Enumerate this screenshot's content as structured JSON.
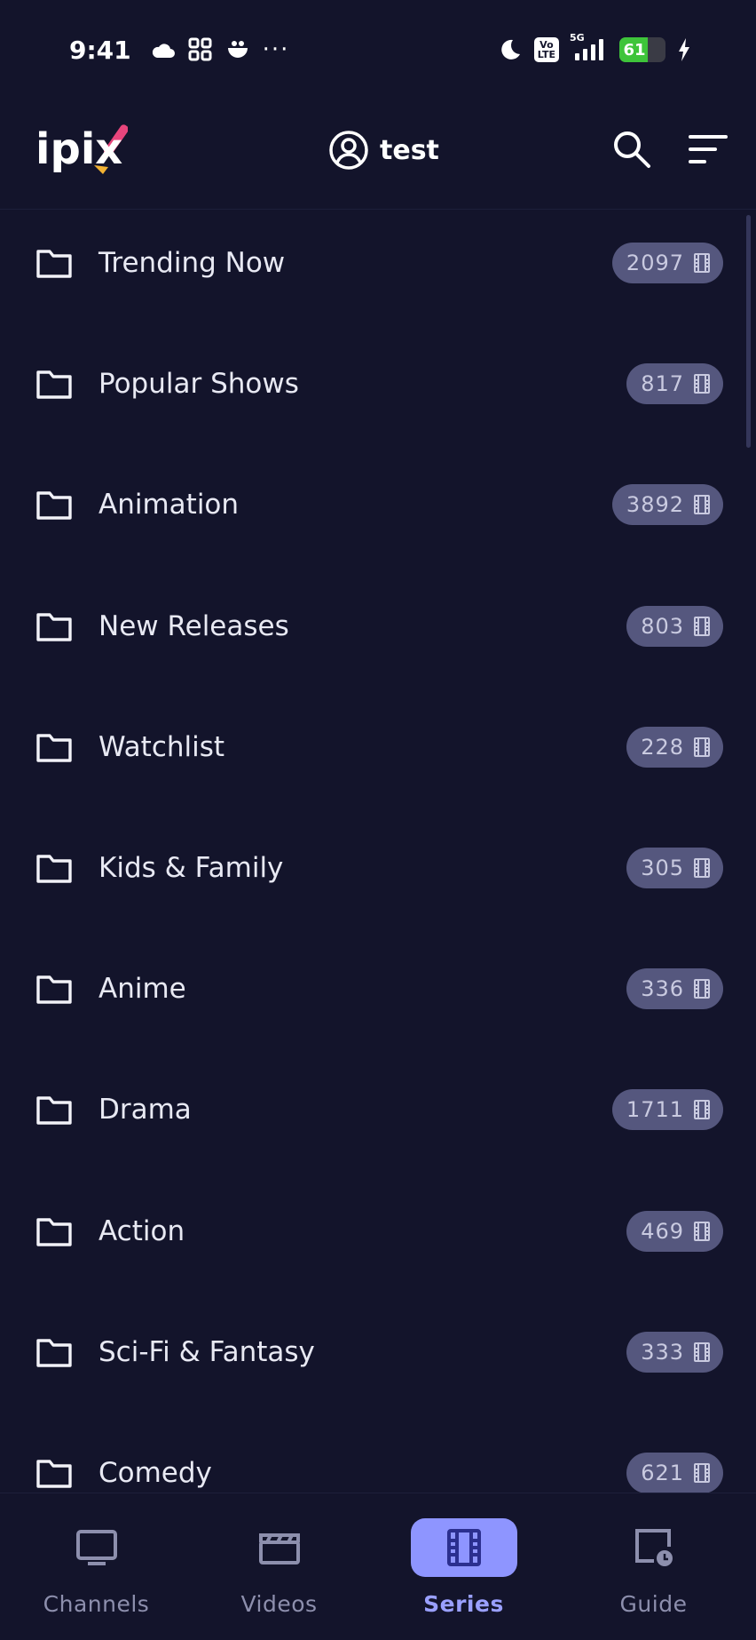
{
  "status_bar": {
    "time": "9:41",
    "network": "5G",
    "volte_top": "Vo",
    "volte_bottom": "LTE",
    "battery": "61",
    "battery_level": 0.61,
    "icons": [
      "cloud-icon",
      "grid-app-icon",
      "robot-icon",
      "more-dots-icon",
      "moon-icon",
      "volte-icon",
      "signal-icon",
      "battery-icon",
      "charging-icon"
    ]
  },
  "header": {
    "logo_text": "ipix",
    "username": "test",
    "icons": [
      "user-circle-icon",
      "search-icon",
      "sort-icon"
    ]
  },
  "categories": [
    {
      "label": "Trending Now",
      "count": "2097"
    },
    {
      "label": "Popular Shows",
      "count": "817"
    },
    {
      "label": "Animation",
      "count": "3892"
    },
    {
      "label": "New Releases",
      "count": "803"
    },
    {
      "label": "Watchlist",
      "count": "228"
    },
    {
      "label": "Kids & Family",
      "count": "305"
    },
    {
      "label": "Anime",
      "count": "336"
    },
    {
      "label": "Drama",
      "count": "1711"
    },
    {
      "label": "Action",
      "count": "469"
    },
    {
      "label": "Sci-Fi & Fantasy",
      "count": "333"
    },
    {
      "label": "Comedy",
      "count": "621"
    }
  ],
  "bottom_nav": {
    "items": [
      {
        "label": "Channels",
        "icon": "tv-icon"
      },
      {
        "label": "Videos",
        "icon": "clapperboard-icon"
      },
      {
        "label": "Series",
        "icon": "film-strip-icon"
      },
      {
        "label": "Guide",
        "icon": "guide-clock-icon"
      }
    ],
    "active": "Series"
  },
  "colors": {
    "background": "#13142b",
    "badge": "#55577e",
    "accent": "#8e95ff",
    "battery": "#3ec43a"
  }
}
